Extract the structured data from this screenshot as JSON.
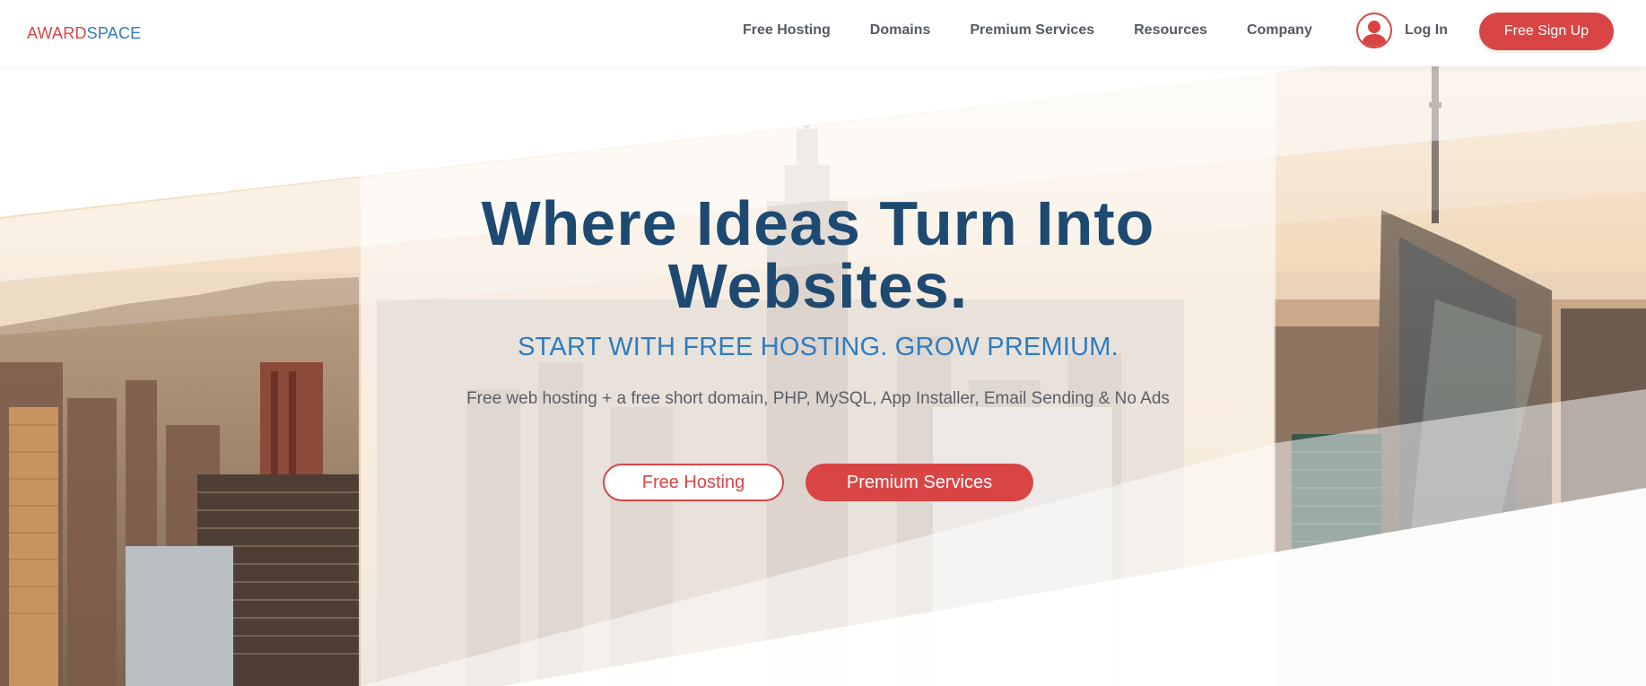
{
  "brand": {
    "logo_part1": "AWARD",
    "logo_part2": "SPACE"
  },
  "nav": {
    "items": [
      {
        "label": "Free Hosting"
      },
      {
        "label": "Domains"
      },
      {
        "label": "Premium Services"
      },
      {
        "label": "Resources"
      },
      {
        "label": "Company"
      }
    ],
    "login_label": "Log In",
    "signup_label": "Free Sign Up"
  },
  "hero": {
    "title_line1": "Where Ideas Turn Into",
    "title_line2": "Websites.",
    "subtitle": "START WITH FREE HOSTING. GROW PREMIUM.",
    "description": "Free web hosting + a free short domain, PHP, MySQL, App Installer, Email Sending & No Ads",
    "btn_free": "Free Hosting",
    "btn_premium": "Premium Services"
  },
  "colors": {
    "accent_red": "#d94545",
    "brand_blue": "#2f7cc1",
    "title_navy": "#1e4a72",
    "nav_text": "#555a61"
  },
  "icons": {
    "user": "user-avatar-icon"
  }
}
